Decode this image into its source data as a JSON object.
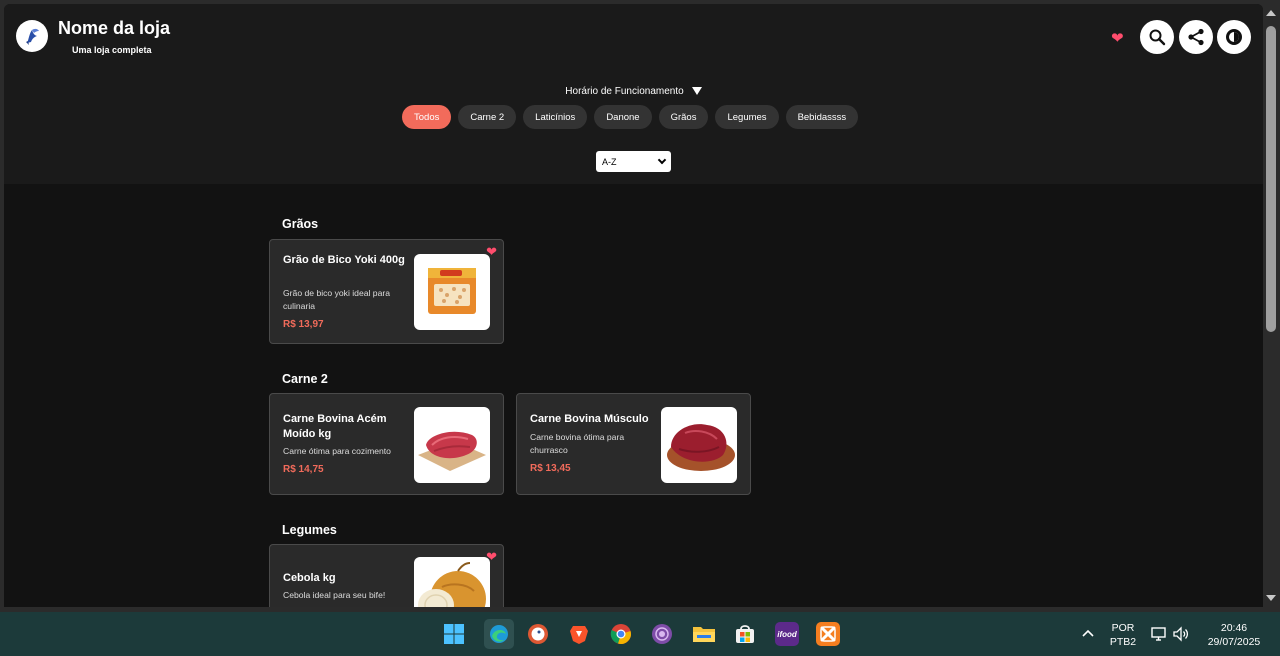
{
  "header": {
    "store_name": "Nome da loja",
    "store_subtitle": "Uma loja completa",
    "icons": [
      "heart-icon",
      "search-icon",
      "share-icon",
      "contrast-icon"
    ]
  },
  "hours_label": "Horário de Funcionamento",
  "categories": [
    {
      "label": "Todos",
      "active": true
    },
    {
      "label": "Carne 2",
      "active": false
    },
    {
      "label": "Laticínios",
      "active": false
    },
    {
      "label": "Danone",
      "active": false
    },
    {
      "label": "Grãos",
      "active": false
    },
    {
      "label": "Legumes",
      "active": false
    },
    {
      "label": "Bebidassss",
      "active": false
    }
  ],
  "sort": {
    "selected": "A-Z"
  },
  "sections": [
    {
      "title": "Grãos",
      "products": [
        {
          "name": "Grão de Bico Yoki 400g",
          "description": "Grão de bico yoki ideal para culinaria",
          "price": "R$ 13,97",
          "favorite": true
        }
      ]
    },
    {
      "title": "Carne 2",
      "products": [
        {
          "name": "Carne Bovina Acém Moído kg",
          "description": "Carne ótima para cozimento",
          "price": "R$ 14,75",
          "favorite": false
        },
        {
          "name": "Carne Bovina Músculo",
          "description": "Carne bovina ótima para churrasco",
          "price": "R$ 13,45",
          "favorite": false
        }
      ]
    },
    {
      "title": "Legumes",
      "products": [
        {
          "name": "Cebola kg",
          "description": "Cebola ideal para seu bife!",
          "price": "",
          "favorite": true
        }
      ]
    }
  ],
  "taskbar": {
    "apps": [
      "windows-start-icon",
      "edge-icon",
      "duckduckgo-icon",
      "brave-icon",
      "chrome-icon",
      "tor-icon",
      "file-explorer-icon",
      "store-icon",
      "ifood-icon",
      "xampp-icon"
    ],
    "ifood_label": "ifood",
    "language": "POR",
    "layout": "PTB2",
    "time": "20:46",
    "date": "29/07/2025"
  },
  "colors": {
    "accent": "#f26b5b",
    "favorite": "#ff4d6d",
    "background": "#121212"
  }
}
